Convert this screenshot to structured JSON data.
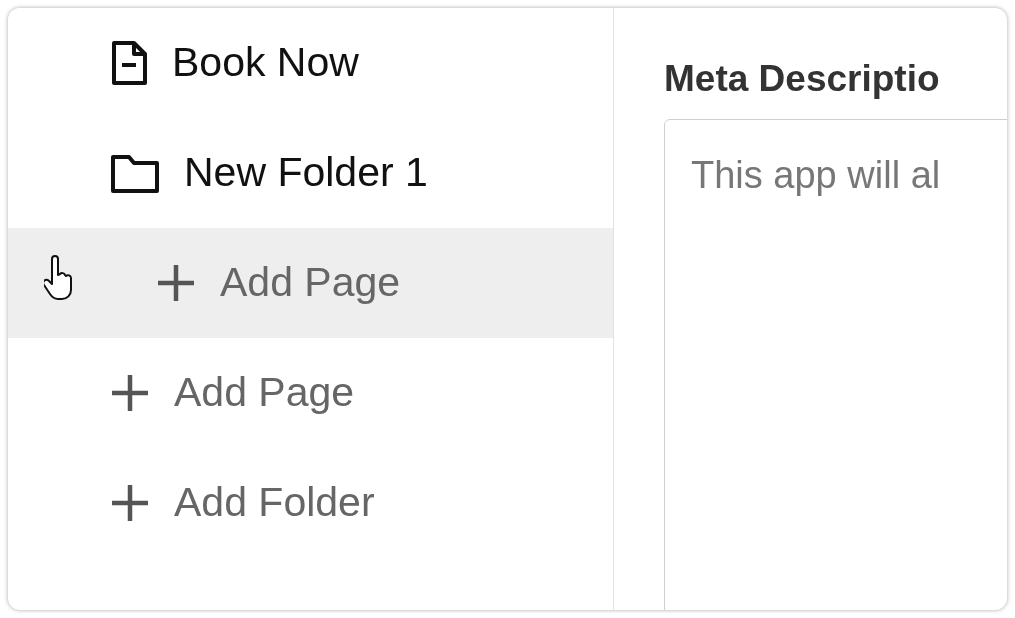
{
  "sidebar": {
    "items": [
      {
        "kind": "page",
        "label": "Book Now"
      },
      {
        "kind": "folder",
        "label": "New Folder 1",
        "children": [
          {
            "kind": "add",
            "label": "Add Page",
            "hovered": true
          }
        ]
      },
      {
        "kind": "add",
        "label": "Add Page",
        "hovered": false
      },
      {
        "kind": "add",
        "label": "Add Folder",
        "hovered": false
      }
    ]
  },
  "editor": {
    "field_label": "Meta Descriptio",
    "textarea": {
      "placeholder": "This app will al"
    }
  }
}
